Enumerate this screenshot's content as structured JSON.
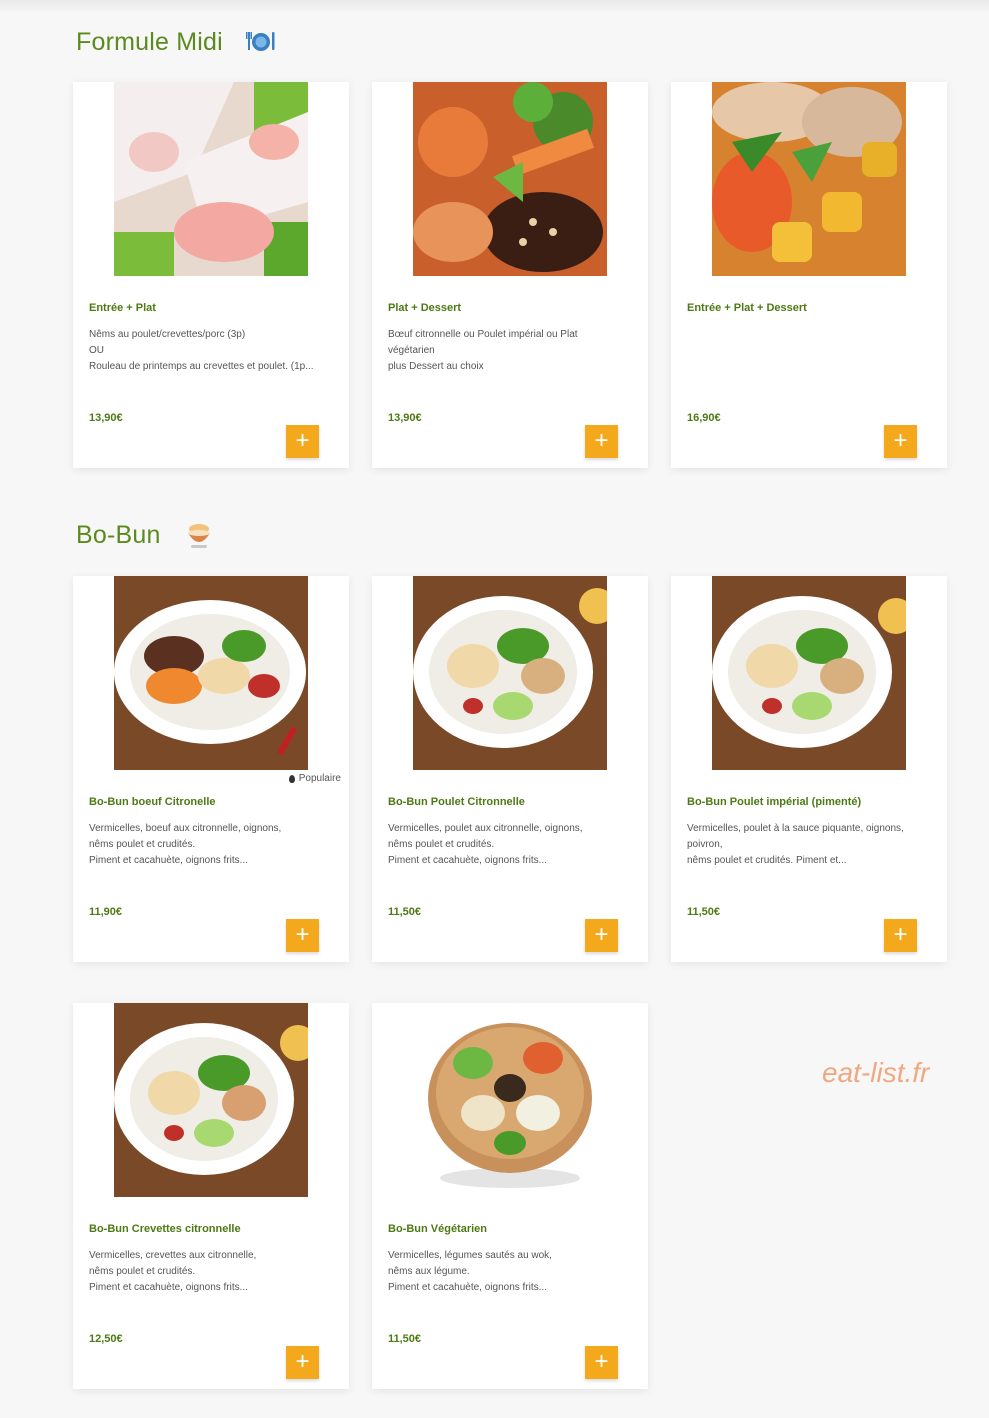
{
  "sections": [
    {
      "title": "Formule Midi",
      "icon": "plate-cutlery-icon",
      "items": [
        {
          "name": "Entrée + Plat",
          "desc": [
            "Nêms au poulet/crevettes/porc   (3p)",
            "OU",
            "Rouleau de printemps au crevettes et poulet.  (1p..."
          ],
          "price": "13,90€",
          "badge": "",
          "image": "spring-rolls-photo"
        },
        {
          "name": "Plat + Dessert",
          "desc": [
            "Bœuf citronnelle ou Poulet impérial ou Plat",
            "végétarien",
            "plus Dessert au choix"
          ],
          "price": "13,90€",
          "badge": "",
          "image": "beef-stirfry-photo"
        },
        {
          "name": "Entrée + Plat + Dessert",
          "desc": [],
          "price": "16,90€",
          "badge": "",
          "image": "shrimp-curry-photo"
        }
      ]
    },
    {
      "title": "Bo-Bun",
      "icon": "bowl-icon",
      "items": [
        {
          "name": "Bo-Bun boeuf Citronelle",
          "desc": [
            "Vermicelles, boeuf aux citronnelle, oignons,",
            "nêms poulet et crudités.",
            "Piment et cacahuète, oignons frits..."
          ],
          "price": "11,90€",
          "badge": "Populaire",
          "image": "bobun-beef-photo"
        },
        {
          "name": "Bo-Bun Poulet Citronnelle",
          "desc": [
            "Vermicelles, poulet aux citronnelle, oignons,",
            "nêms poulet et crudités.",
            "Piment et cacahuète, oignons frits..."
          ],
          "price": "11,50€",
          "badge": "",
          "image": "bobun-chicken-photo"
        },
        {
          "name": "Bo-Bun Poulet impérial (pimenté)",
          "desc": [
            "Vermicelles, poulet à la sauce piquante, oignons,",
            "poivron,",
            "nêms poulet et crudités. Piment et..."
          ],
          "price": "11,50€",
          "badge": "",
          "image": "bobun-spicy-chicken-photo"
        },
        {
          "name": "Bo-Bun Crevettes citronnelle",
          "desc": [
            "Vermicelles, crevettes aux citronnelle,",
            "nêms poulet et crudités.",
            "Piment et cacahuète, oignons frits..."
          ],
          "price": "12,50€",
          "badge": "",
          "image": "bobun-shrimp-photo"
        },
        {
          "name": "Bo-Bun Végétarien",
          "desc": [
            "Vermicelles, légumes sautés au wok,",
            "nêms aux légume.",
            "Piment et cacahuète, oignons frits..."
          ],
          "price": "11,50€",
          "badge": "",
          "image": "bobun-vegetarian-photo"
        }
      ]
    }
  ],
  "add_label": "+",
  "watermark": "eat-list.fr",
  "colors": {
    "accent_green": "#5b8a1e",
    "button_orange": "#f4a81c",
    "watermark": "#f0a880"
  }
}
